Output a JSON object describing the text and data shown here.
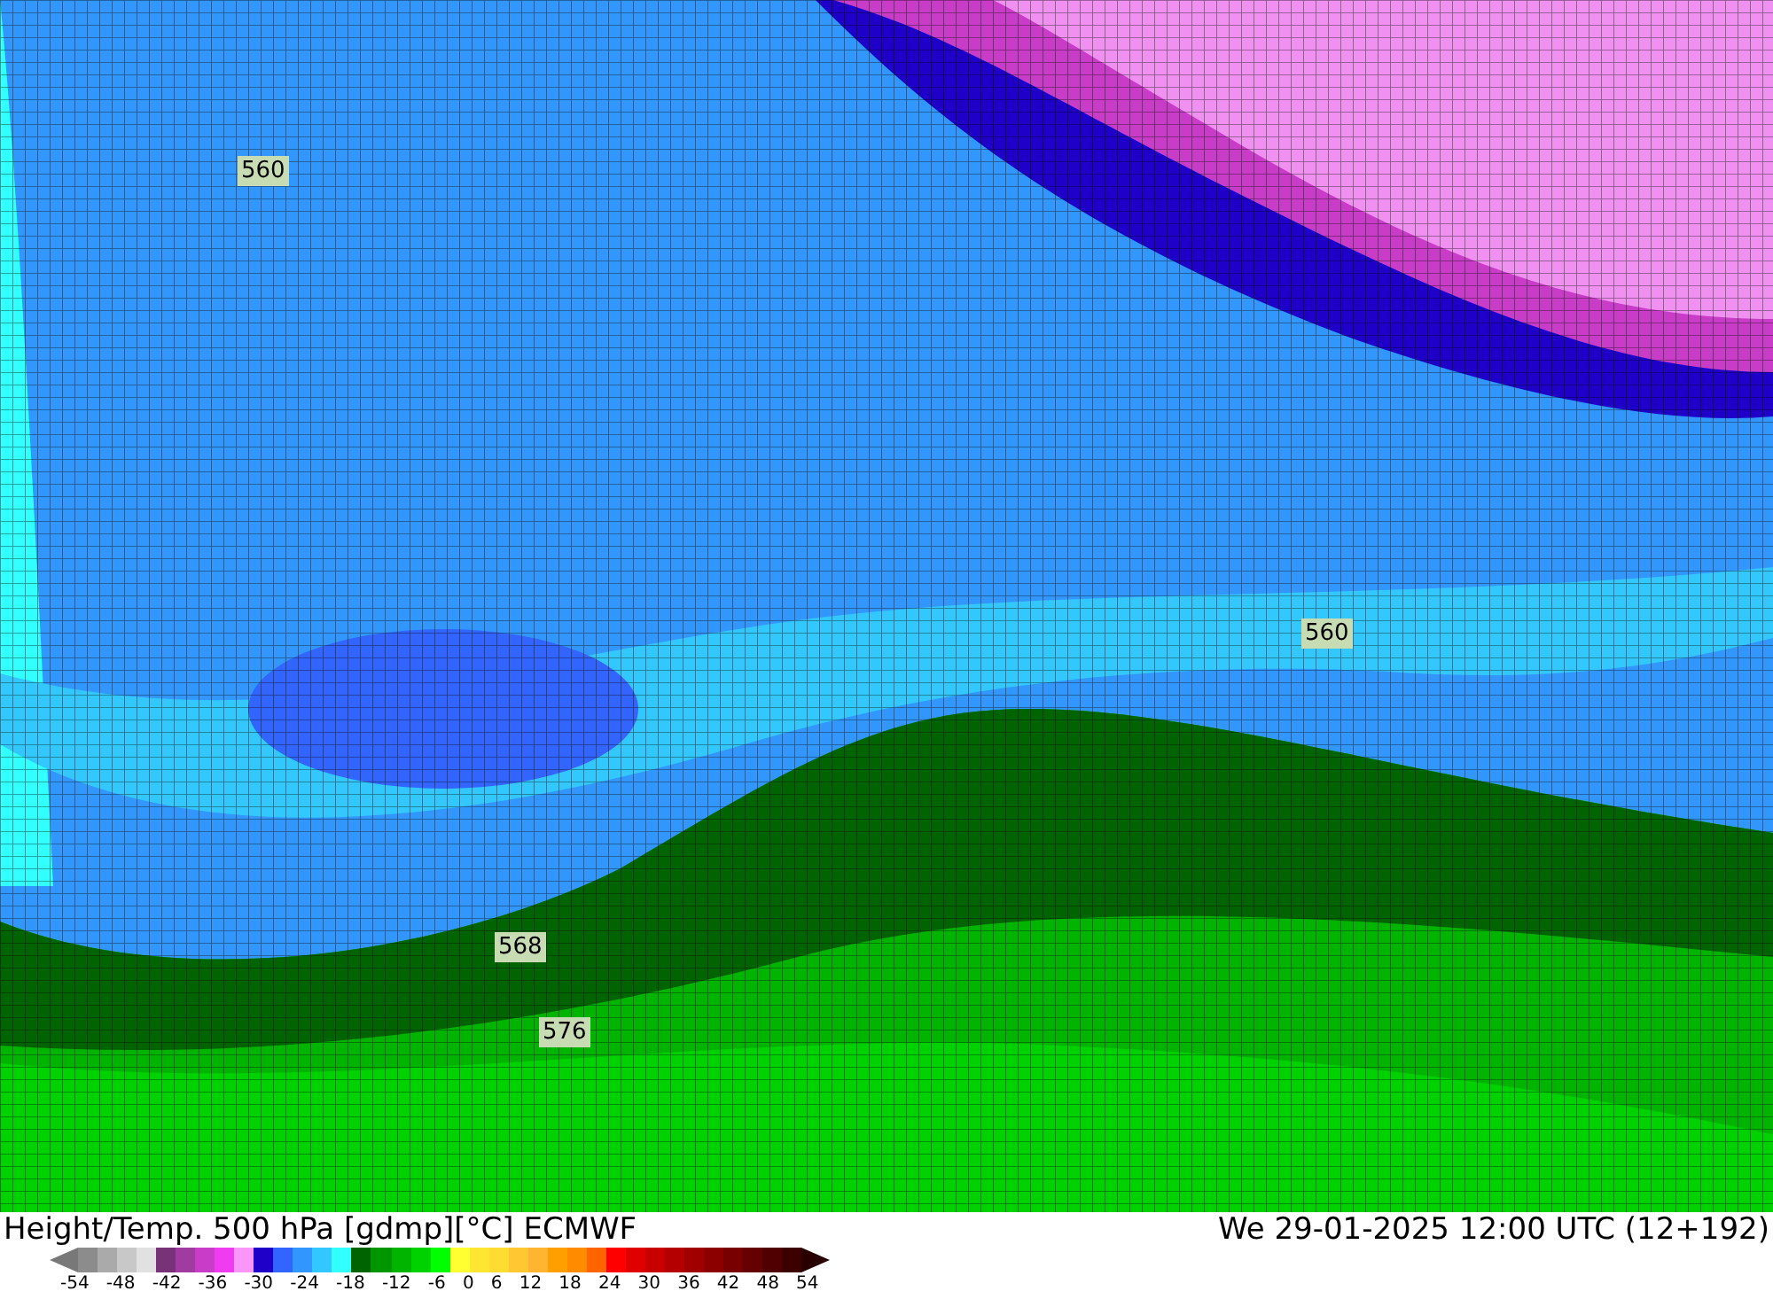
{
  "map": {
    "contour_labels": [
      {
        "text": "560"
      },
      {
        "text": "560"
      },
      {
        "text": "568"
      },
      {
        "text": "576"
      }
    ]
  },
  "footer": {
    "title": "Height/Temp. 500 hPa [gdmp][°C] ECMWF",
    "datetime": "We 29-01-2025 12:00 UTC (12+192)"
  },
  "legend": {
    "colors": [
      {
        "color": "#8c8c8c"
      },
      {
        "color": "#aaaaaa"
      },
      {
        "color": "#c8c8c8"
      },
      {
        "color": "#e1e1e1"
      },
      {
        "color": "#783278"
      },
      {
        "color": "#a03ca0"
      },
      {
        "color": "#c83cc8"
      },
      {
        "color": "#f03cf0"
      },
      {
        "color": "#fa96fa"
      },
      {
        "color": "#1e00c8"
      },
      {
        "color": "#3264ff"
      },
      {
        "color": "#3296ff"
      },
      {
        "color": "#32c8ff"
      },
      {
        "color": "#32ffff"
      },
      {
        "color": "#006400"
      },
      {
        "color": "#009600"
      },
      {
        "color": "#00b400"
      },
      {
        "color": "#00d200"
      },
      {
        "color": "#00ff00"
      },
      {
        "color": "#ffff32"
      },
      {
        "color": "#ffe632"
      },
      {
        "color": "#ffdc32"
      },
      {
        "color": "#ffc832"
      },
      {
        "color": "#ffb432"
      },
      {
        "color": "#ffa000"
      },
      {
        "color": "#ff8c00"
      },
      {
        "color": "#ff6400"
      },
      {
        "color": "#ff0000"
      },
      {
        "color": "#e10000"
      },
      {
        "color": "#c80000"
      },
      {
        "color": "#b40000"
      },
      {
        "color": "#a00000"
      },
      {
        "color": "#8c0000"
      },
      {
        "color": "#780000"
      },
      {
        "color": "#640000"
      },
      {
        "color": "#500000"
      },
      {
        "color": "#3c0000"
      }
    ],
    "ticks": [
      "-54",
      "-48",
      "-42",
      "-36",
      "-30",
      "-24",
      "-18",
      "-12",
      "-6",
      "0",
      "6",
      "12",
      "18",
      "24",
      "30",
      "36",
      "42",
      "48",
      "54"
    ]
  }
}
